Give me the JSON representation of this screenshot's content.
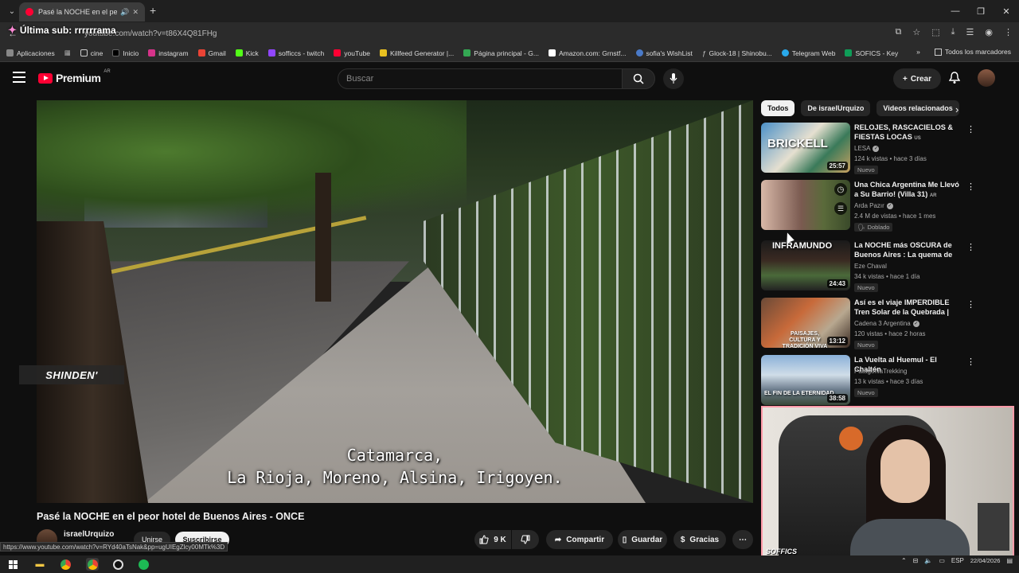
{
  "browser": {
    "tab_title": "Pasé la NOCHE en el peor hotel de Buenos Aires - ONCE",
    "url": "youtube.com/watch?v=t86X4Q81FHg",
    "status_url": "https://www.youtube.com/watch?v=RYd40aTsNak&pp=ugUIEgZlcy00MTk%3D",
    "overlay_sub": "Última sub: rrrrrrama",
    "bookmarks": [
      "Aplicaciones",
      "cine",
      "Inicio",
      "instagram",
      "Gmail",
      "Kick",
      "sofficcs - twitch",
      "youTube",
      "Killfeed Generator |...",
      "Página principal - G...",
      "Amazon.com: Grnstf...",
      "sofia's WishList",
      "Glock-18 | Shinobu...",
      "Telegram Web",
      "SOFICS - Key"
    ],
    "bookmarks_all": "Todos los marcadores"
  },
  "youtube": {
    "logo_word": "Premium",
    "logo_region": "AR",
    "search_placeholder": "Buscar",
    "create_label": "Crear"
  },
  "video": {
    "overlay_brand": "SHINDEN'",
    "subtitle_line1": "Catamarca,",
    "subtitle_line2": "La Rioja, Moreno, Alsina, Irigoyen.",
    "title": "Pasé la NOCHE en el peor hotel de Buenos Aires - ONCE",
    "channel": "israelUrquizo",
    "join_label": "Unirse",
    "subscribe_label": "Suscribirse",
    "likes": "9 K",
    "share_label": "Compartir",
    "save_label": "Guardar",
    "thanks_label": "Gracias"
  },
  "sidebar": {
    "chips": [
      "Todos",
      "De israelUrquizo",
      "Videos relacionados"
    ],
    "items": [
      {
        "title": "RELOJES, RASCACIELOS & FIESTAS LOCAS",
        "title_badge": "US",
        "channel": "LESA",
        "verified": true,
        "meta": "124 k vistas • hace 3 días",
        "tag": "Nuevo",
        "duration": "25:57",
        "thumb_text": "BRICKELL"
      },
      {
        "title": "Una Chica Argentina Me Llevó a Su Barrio! (Villa 31)",
        "title_badge": "AR",
        "channel": "Arda Pazır",
        "verified": true,
        "meta": "2.4 M de vistas • hace 1 mes",
        "tag": "Doblado",
        "duration": "",
        "thumb_text": ""
      },
      {
        "title": "La NOCHE más OSCURA de Buenos Aires : La quema de ...",
        "title_badge": "",
        "channel": "Eze Chaval",
        "verified": false,
        "meta": "34 k vistas • hace 1 día",
        "tag": "Nuevo",
        "duration": "24:43",
        "thumb_text": "INFRAMUNDO"
      },
      {
        "title": "Así es el viaje IMPERDIBLE Tren Solar de la Quebrada | Cadena ...",
        "title_badge": "",
        "channel": "Cadena 3 Argentina",
        "verified": true,
        "meta": "120 vistas • hace 2 horas",
        "tag": "Nuevo",
        "duration": "13:12",
        "thumb_text": "PAISAJES, CULTURA Y TRADICIÓN VIVA"
      },
      {
        "title": "La Vuelta al Huemul - El Chaltén",
        "title_badge": "",
        "channel": "PatagoniaTrekking",
        "verified": false,
        "meta": "13 k vistas • hace 3 días",
        "tag": "Nuevo",
        "duration": "38:58",
        "thumb_text": "EL FIN DE LA ETERNIDAD"
      }
    ]
  },
  "webcam": {
    "label": "SOFFICS"
  },
  "taskbar": {
    "lang": "ESP",
    "date": "22/04/2026"
  }
}
